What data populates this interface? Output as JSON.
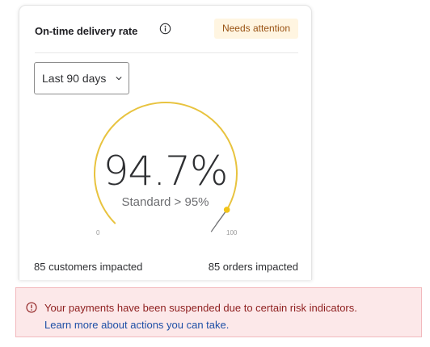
{
  "card": {
    "title": "On-time delivery rate",
    "info_icon": "info-circle-icon",
    "badge": "Needs attention",
    "colors": {
      "badge_bg": "#fff5e1",
      "badge_text": "#995213",
      "gauge_arc": "#e8c33f"
    }
  },
  "range_select": {
    "value": "Last 90 days",
    "icon": "chevron-down-icon"
  },
  "gauge": {
    "value_text": "94.7%",
    "value": 94.7,
    "standard_text": "Standard > 95%",
    "min_label": "0",
    "max_label": "100",
    "min": 0,
    "max": 100
  },
  "stats": {
    "customers": "85 customers impacted",
    "orders": "85 orders impacted"
  },
  "alert": {
    "icon": "alert-circle-icon",
    "message": "Your payments have been suspended due to certain risk indicators.",
    "link": "Learn more about actions you can take.",
    "colors": {
      "bg": "#fce8e9",
      "text": "#8e1e1e",
      "link": "#1e4fa6"
    }
  }
}
